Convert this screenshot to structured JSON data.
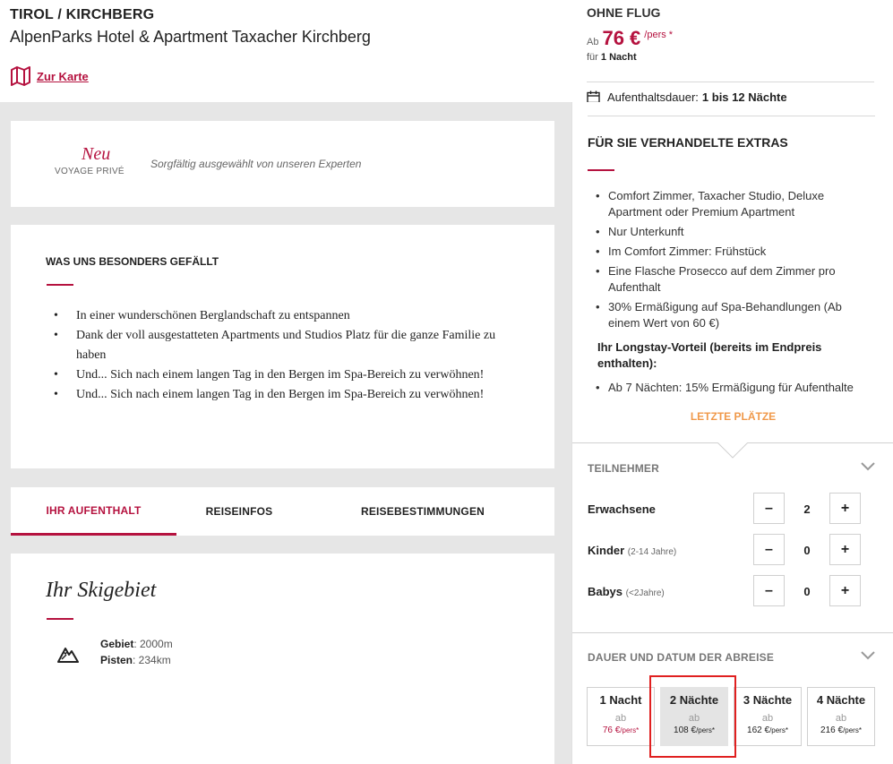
{
  "header": {
    "region": "TIROL / KIRCHBERG",
    "hotel_name": "AlpenParks Hotel & Apartment Taxacher Kirchberg",
    "map_link": "Zur Karte"
  },
  "new_card": {
    "neu": "Neu",
    "brand": "VOYAGE PRIVÉ",
    "tagline": "Sorgfältig ausgewählt von unseren Experten"
  },
  "highlights": {
    "title": "WAS UNS BESONDERS GEFÄLLT",
    "items": [
      "In einer wunderschönen Berglandschaft zu entspannen",
      "Dank der voll ausgestatteten Apartments und Studios Platz für die ganze Familie zu haben",
      "Und... Sich nach einem langen Tag in den Bergen im Spa-Bereich zu verwöhnen!",
      "Und... Sich nach einem langen Tag in den Bergen im Spa-Bereich zu verwöhnen!"
    ]
  },
  "tabs": [
    "IHR AUFENTHALT",
    "REISEINFOS",
    "REISEBESTIMMUNGEN"
  ],
  "ski": {
    "title": "Ihr Skigebiet",
    "gebiet_label": "Gebiet",
    "gebiet_value": ": 2000m",
    "pisten_label": "Pisten",
    "pisten_value": ": 234km"
  },
  "offer": {
    "mode": "OHNE FLUG",
    "ab": "Ab",
    "price": "76 €",
    "price_unit": "/pers *",
    "fuer": "für",
    "fuer_value": "1 Nacht",
    "stay_label": "Aufenthaltsdauer:",
    "stay_value": "1 bis 12 Nächte"
  },
  "extras": {
    "title": "FÜR SIE VERHANDELTE EXTRAS",
    "items": [
      "Comfort Zimmer, Taxacher Studio, Deluxe Apartment oder Premium Apartment",
      "Nur Unterkunft",
      "Im Comfort Zimmer: Frühstück",
      "Eine Flasche Prosecco auf dem Zimmer pro Aufenthalt",
      "30% Ermäßigung auf Spa-Behandlungen (Ab einem Wert von 60 €)"
    ],
    "longstay_title": "Ihr Longstay-Vorteil (bereits im Endpreis enthalten):",
    "longstay_items": [
      "Ab 7 Nächten: 15% Ermäßigung für Aufenthalte"
    ],
    "letzte": "LETZTE PLÄTZE"
  },
  "participants": {
    "title": "TEILNEHMER",
    "rows": [
      {
        "label": "Erwachsene",
        "note": "",
        "value": "2"
      },
      {
        "label": "Kinder",
        "note": "(2-14 Jahre)",
        "value": "0"
      },
      {
        "label": "Babys",
        "note": "(<2Jahre)",
        "value": "0"
      }
    ],
    "minus": "–",
    "plus": "+"
  },
  "duration": {
    "title": "DAUER UND DATUM DER ABREISE",
    "options": [
      {
        "label": "1 Nacht",
        "ab": "ab",
        "price": "76 €",
        "unit": "/pers*"
      },
      {
        "label": "2 Nächte",
        "ab": "ab",
        "price": "108 €",
        "unit": "/pers*"
      },
      {
        "label": "3 Nächte",
        "ab": "ab",
        "price": "162 €",
        "unit": "/pers*"
      },
      {
        "label": "4 Nächte",
        "ab": "ab",
        "price": "216 €",
        "unit": "/pers*"
      }
    ]
  },
  "colors": {
    "accent": "#b5123f",
    "warning": "#f0994a",
    "highlight_border": "#e02020"
  }
}
